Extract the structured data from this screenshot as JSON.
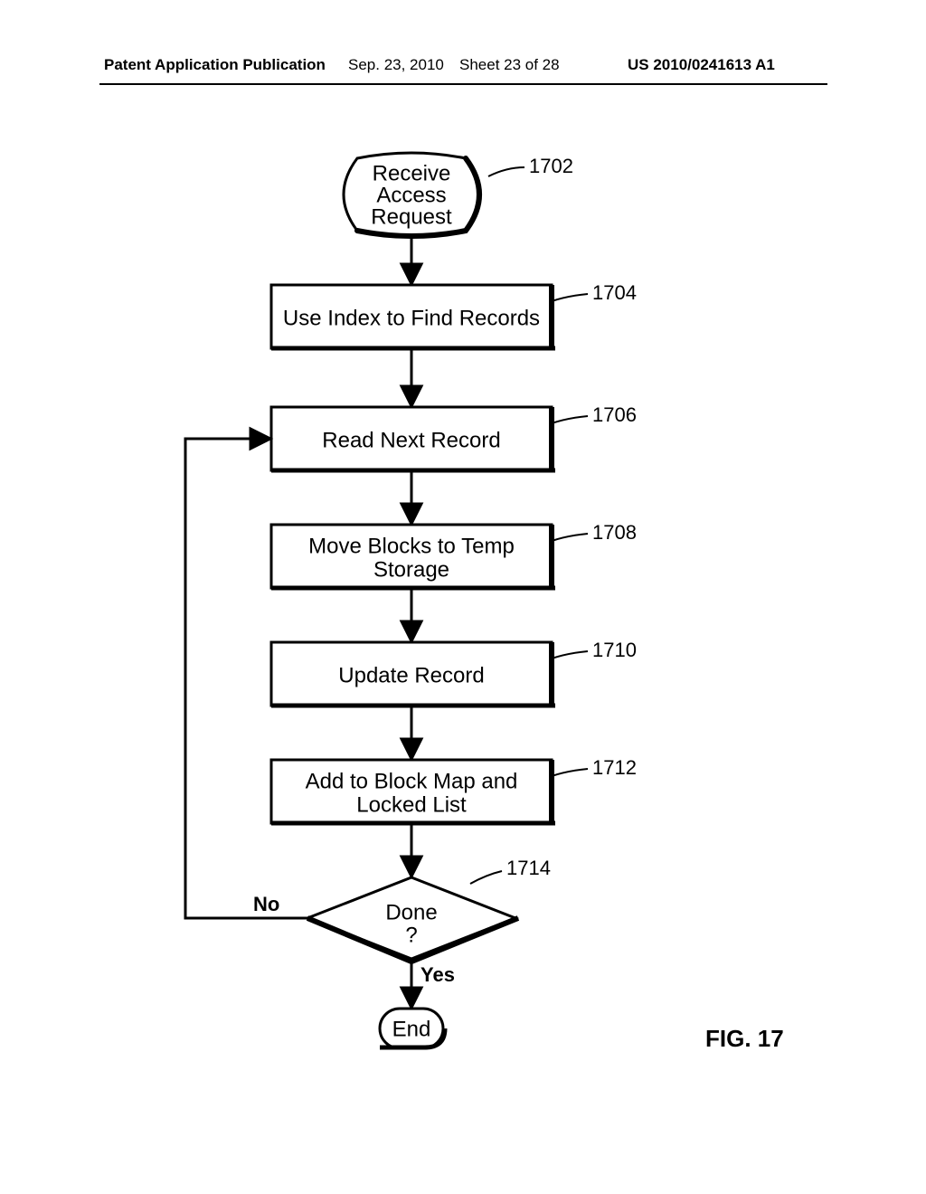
{
  "header": {
    "publication": "Patent Application Publication",
    "date": "Sep. 23, 2010",
    "sheet": "Sheet 23 of 28",
    "number": "US 2010/0241613 A1"
  },
  "flowchart": {
    "startBox": {
      "line1": "Receive",
      "line2": "Access",
      "line3": "Request",
      "ref": "1702"
    },
    "step1": {
      "text": "Use Index to Find Records",
      "ref": "1704"
    },
    "step2": {
      "text": "Read Next Record",
      "ref": "1706"
    },
    "step3": {
      "line1": "Move Blocks to Temp",
      "line2": "Storage",
      "ref": "1708"
    },
    "step4": {
      "text": "Update Record",
      "ref": "1710"
    },
    "step5": {
      "line1": "Add to Block Map and",
      "line2": "Locked List",
      "ref": "1712"
    },
    "decision": {
      "line1": "Done",
      "line2": "?",
      "ref": "1714"
    },
    "branchNo": "No",
    "branchYes": "Yes",
    "endBox": {
      "text": "End"
    }
  },
  "figureLabel": "FIG. 17"
}
